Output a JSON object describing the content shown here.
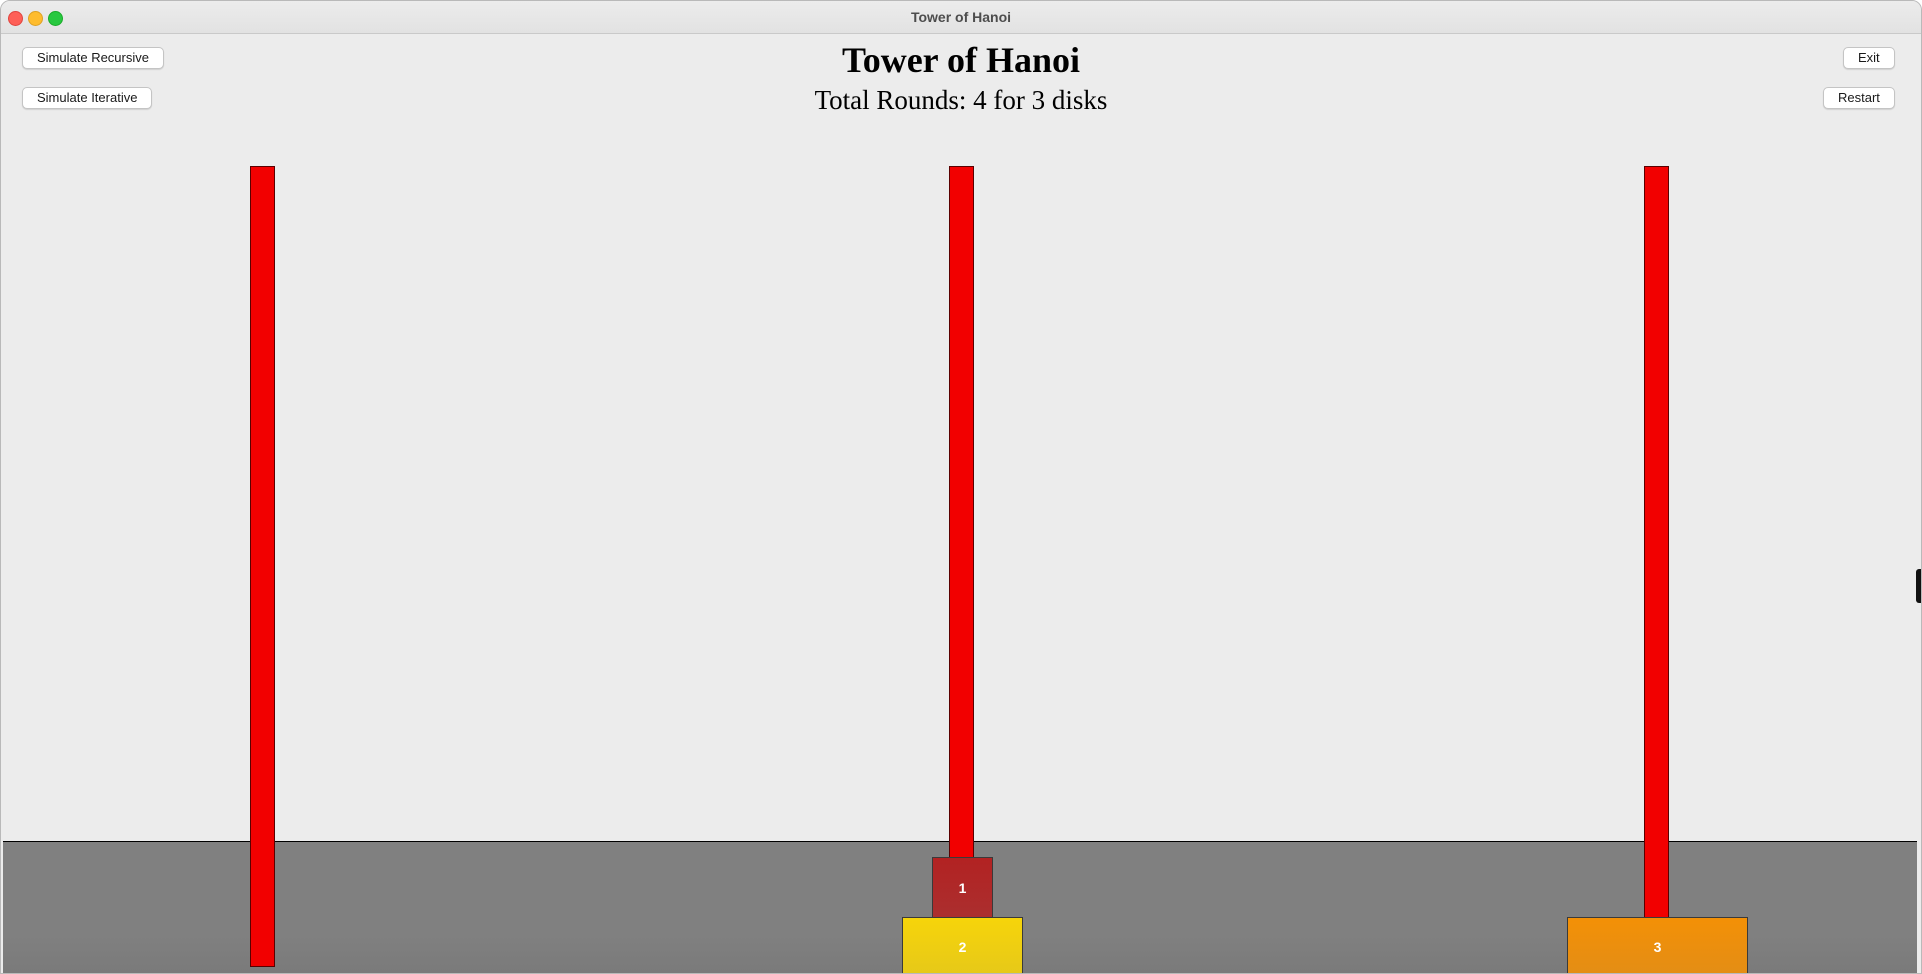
{
  "window": {
    "title": "Tower of Hanoi"
  },
  "header": {
    "title": "Tower of Hanoi",
    "subtitle": "Total Rounds: 4 for 3 disks"
  },
  "buttons": {
    "simulate_recursive": "Simulate Recursive",
    "simulate_iterative": "Simulate Iterative",
    "exit": "Exit",
    "restart": "Restart"
  },
  "game": {
    "rounds": 4,
    "disk_count": 3,
    "pegs": [
      {
        "name": "left",
        "disks": []
      },
      {
        "name": "middle",
        "disks": [
          "1",
          "2"
        ]
      },
      {
        "name": "right",
        "disks": [
          "3"
        ]
      }
    ],
    "disks": [
      {
        "label": "1",
        "color": "#b22222"
      },
      {
        "label": "2",
        "color": "#f6d40a"
      },
      {
        "label": "3",
        "color": "#f39006"
      }
    ],
    "peg_color": "#f20000",
    "ground_color": "#808080"
  }
}
